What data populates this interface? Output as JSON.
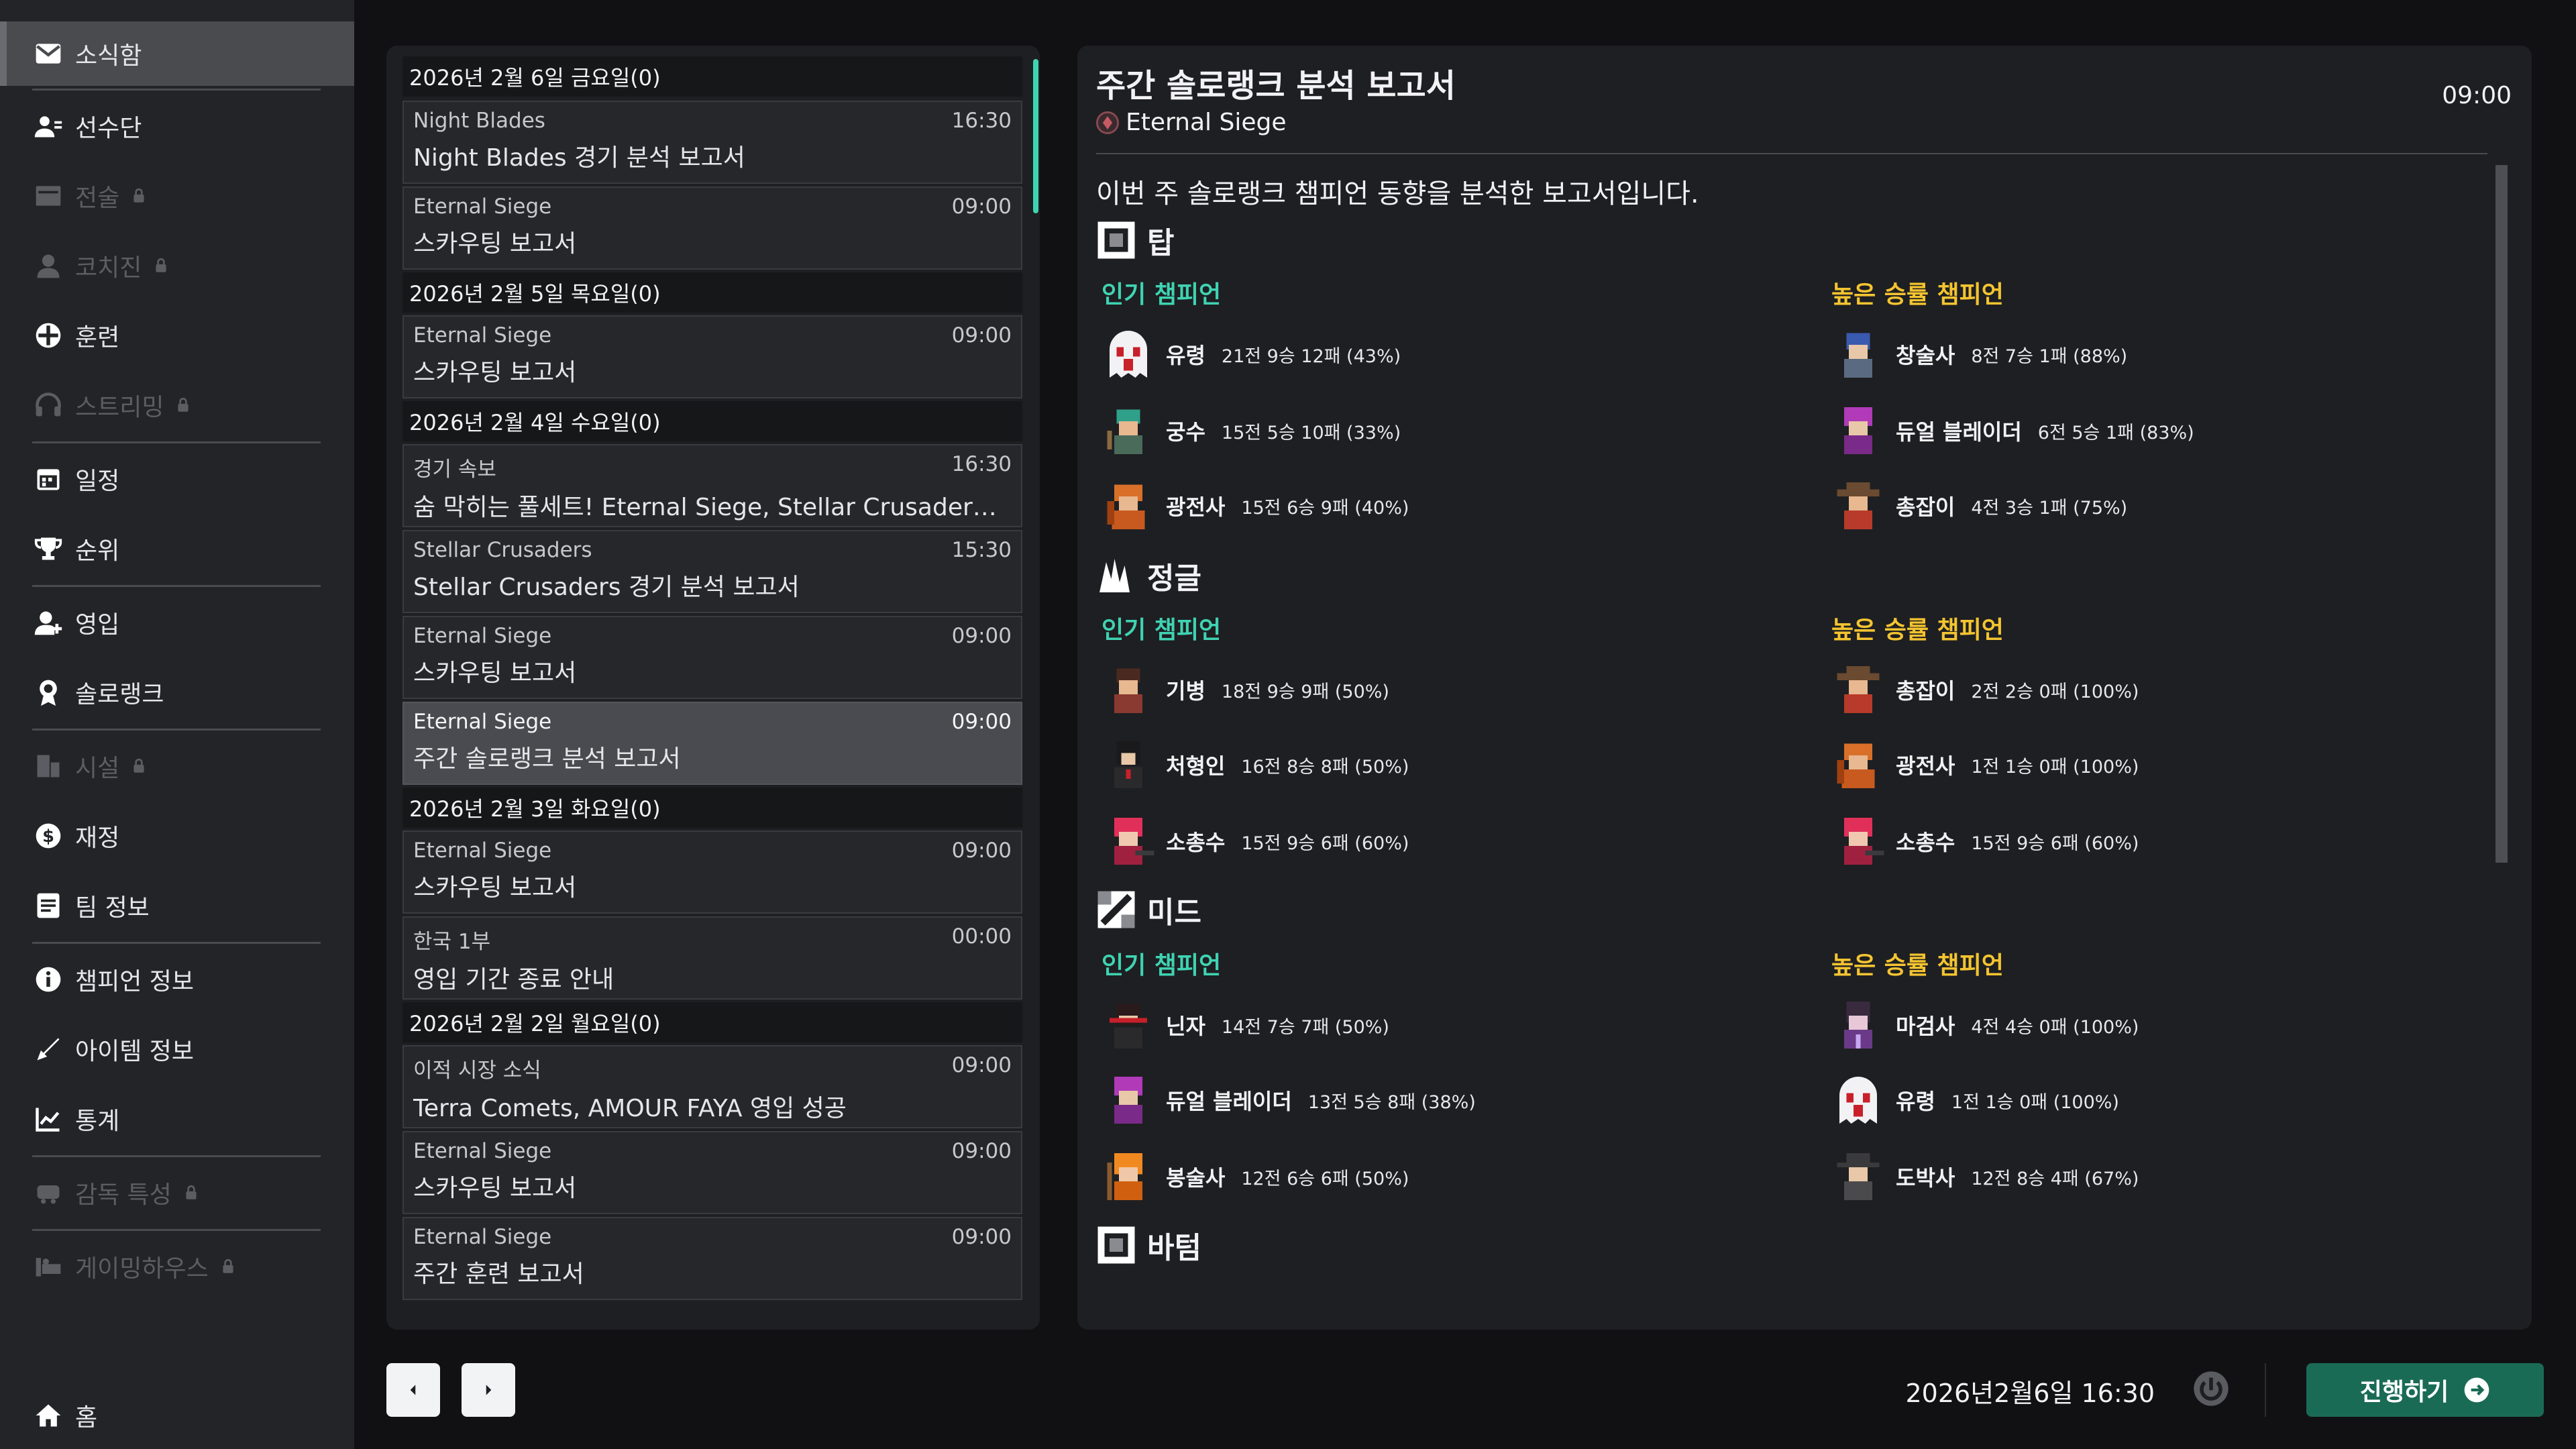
{
  "sidebar": {
    "items": [
      {
        "label": "소식함",
        "icon": "mail-icon",
        "locked": false,
        "active": true
      },
      {
        "label": "선수단",
        "icon": "roster-icon",
        "locked": false
      },
      {
        "label": "전술",
        "icon": "tactics-icon",
        "locked": true
      },
      {
        "label": "코치진",
        "icon": "coach-icon",
        "locked": true
      },
      {
        "label": "훈련",
        "icon": "training-icon",
        "locked": false
      },
      {
        "label": "스트리밍",
        "icon": "headset-icon",
        "locked": true
      },
      {
        "label": "일정",
        "icon": "calendar-icon",
        "locked": false
      },
      {
        "label": "순위",
        "icon": "trophy-icon",
        "locked": false
      },
      {
        "label": "영입",
        "icon": "recruit-icon",
        "locked": false
      },
      {
        "label": "솔로랭크",
        "icon": "solorank-icon",
        "locked": false
      },
      {
        "label": "시설",
        "icon": "facility-icon",
        "locked": true
      },
      {
        "label": "재정",
        "icon": "finance-icon",
        "locked": false
      },
      {
        "label": "팀 정보",
        "icon": "team-info-icon",
        "locked": false
      },
      {
        "label": "챔피언 정보",
        "icon": "info-icon",
        "locked": false
      },
      {
        "label": "아이템 정보",
        "icon": "item-icon",
        "locked": false
      },
      {
        "label": "통계",
        "icon": "chart-icon",
        "locked": false
      },
      {
        "label": "감독 특성",
        "icon": "manager-trait-icon",
        "locked": true
      },
      {
        "label": "게이밍하우스",
        "icon": "gaming-house-icon",
        "locked": true
      }
    ],
    "home_label": "홈"
  },
  "inbox": {
    "groups": [
      {
        "date": "2026년 2월 6일 금요일(0)",
        "messages": [
          {
            "sender": "Night Blades",
            "time": "16:30",
            "title": "Night Blades 경기 분석 보고서"
          },
          {
            "sender": "Eternal Siege",
            "time": "09:00",
            "title": "스카우팅 보고서"
          }
        ]
      },
      {
        "date": "2026년 2월 5일 목요일(0)",
        "messages": [
          {
            "sender": "Eternal Siege",
            "time": "09:00",
            "title": "스카우팅 보고서"
          }
        ]
      },
      {
        "date": "2026년 2월 4일 수요일(0)",
        "messages": [
          {
            "sender": "경기 속보",
            "time": "16:30",
            "title": "숨 막히는 풀세트! Eternal Siege, Stellar Crusaders과의 ..."
          },
          {
            "sender": "Stellar Crusaders",
            "time": "15:30",
            "title": "Stellar Crusaders 경기 분석 보고서"
          },
          {
            "sender": "Eternal Siege",
            "time": "09:00",
            "title": "스카우팅 보고서"
          },
          {
            "sender": "Eternal Siege",
            "time": "09:00",
            "title": "주간 솔로랭크 분석 보고서",
            "selected": true
          }
        ]
      },
      {
        "date": "2026년 2월 3일 화요일(0)",
        "messages": [
          {
            "sender": "Eternal Siege",
            "time": "09:00",
            "title": "스카우팅 보고서"
          },
          {
            "sender": "한국 1부",
            "time": "00:00",
            "title": "영입 기간 종료 안내"
          }
        ]
      },
      {
        "date": "2026년 2월 2일 월요일(0)",
        "messages": [
          {
            "sender": "이적 시장 소식",
            "time": "09:00",
            "title": "Terra Comets, AMOUR FAYA 영입 성공"
          },
          {
            "sender": "Eternal Siege",
            "time": "09:00",
            "title": "스카우팅 보고서"
          },
          {
            "sender": "Eternal Siege",
            "time": "09:00",
            "title": "주간 훈련 보고서"
          }
        ]
      }
    ]
  },
  "detail": {
    "title": "주간 솔로랭크 분석 보고서",
    "sender": "Eternal Siege",
    "time": "09:00",
    "intro": "이번 주 솔로랭크 챔피언 동향을 분석한 보고서입니다.",
    "popular_label": "인기 챔피언",
    "winrate_label": "높은 승률 챔피언",
    "roles": [
      {
        "name": "탑",
        "icon": "top-lane-icon",
        "popular": [
          {
            "name": "유령",
            "stat": "21전 9승 12패 (43%)",
            "avatar": "ghost"
          },
          {
            "name": "궁수",
            "stat": "15전 5승 10패 (33%)",
            "avatar": "archer"
          },
          {
            "name": "광전사",
            "stat": "15전 6승 9패 (40%)",
            "avatar": "berserker"
          }
        ],
        "winrate": [
          {
            "name": "창술사",
            "stat": "8전 7승 1패 (88%)",
            "avatar": "lancer"
          },
          {
            "name": "듀얼 블레이더",
            "stat": "6전 5승 1패 (83%)",
            "avatar": "dualblader"
          },
          {
            "name": "총잡이",
            "stat": "4전 3승 1패 (75%)",
            "avatar": "gunslinger"
          }
        ]
      },
      {
        "name": "정글",
        "icon": "jungle-icon",
        "popular": [
          {
            "name": "기병",
            "stat": "18전 9승 9패 (50%)",
            "avatar": "cavalry"
          },
          {
            "name": "처형인",
            "stat": "16전 8승 8패 (50%)",
            "avatar": "executioner"
          },
          {
            "name": "소총수",
            "stat": "15전 9승 6패 (60%)",
            "avatar": "rifleman"
          }
        ],
        "winrate": [
          {
            "name": "총잡이",
            "stat": "2전 2승 0패 (100%)",
            "avatar": "gunslinger"
          },
          {
            "name": "광전사",
            "stat": "1전 1승 0패 (100%)",
            "avatar": "berserker"
          },
          {
            "name": "소총수",
            "stat": "15전 9승 6패 (60%)",
            "avatar": "rifleman"
          }
        ]
      },
      {
        "name": "미드",
        "icon": "mid-lane-icon",
        "popular": [
          {
            "name": "닌자",
            "stat": "14전 7승 7패 (50%)",
            "avatar": "ninja"
          },
          {
            "name": "듀얼 블레이더",
            "stat": "13전 5승 8패 (38%)",
            "avatar": "dualblader"
          },
          {
            "name": "봉술사",
            "stat": "12전 6승 6패 (50%)",
            "avatar": "monk"
          }
        ],
        "winrate": [
          {
            "name": "마검사",
            "stat": "4전 4승 0패 (100%)",
            "avatar": "spellblade"
          },
          {
            "name": "유령",
            "stat": "1전 1승 0패 (100%)",
            "avatar": "ghost"
          },
          {
            "name": "도박사",
            "stat": "12전 8승 4패 (67%)",
            "avatar": "gambler"
          }
        ]
      },
      {
        "name": "바텀",
        "icon": "bottom-lane-icon",
        "popular": [],
        "winrate": []
      }
    ]
  },
  "footer": {
    "prev_icon": "chevron-left-icon",
    "next_icon": "chevron-right-icon",
    "game_date": "2026년2월6일 16:30",
    "proceed_label": "진행하기"
  },
  "colors": {
    "accent_teal": "#3fd3b2",
    "accent_gold": "#f4c430",
    "proceed_green": "#1a6b55"
  }
}
